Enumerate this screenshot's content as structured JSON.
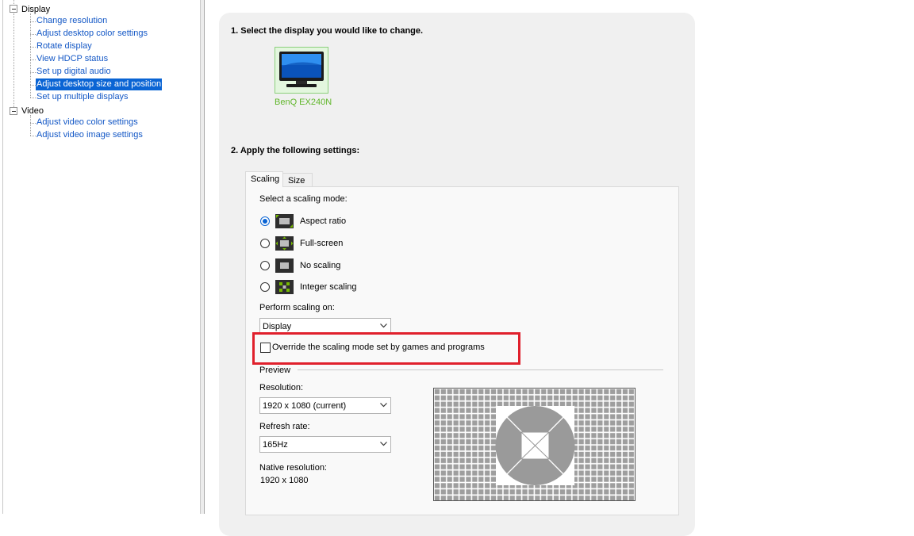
{
  "nav": {
    "categories": [
      {
        "label": "Display",
        "items": [
          {
            "label": "Change resolution"
          },
          {
            "label": "Adjust desktop color settings"
          },
          {
            "label": "Rotate display"
          },
          {
            "label": "View HDCP status"
          },
          {
            "label": "Set up digital audio"
          },
          {
            "label": "Adjust desktop size and position",
            "selected": true
          },
          {
            "label": "Set up multiple displays"
          }
        ]
      },
      {
        "label": "Video",
        "items": [
          {
            "label": "Adjust video color settings"
          },
          {
            "label": "Adjust video image settings"
          }
        ]
      }
    ]
  },
  "step1": {
    "title": "1. Select the display you would like to change.",
    "display_name": "BenQ EX240N"
  },
  "step2": {
    "title": "2. Apply the following settings:",
    "tabs": [
      {
        "label": "Scaling",
        "active": true
      },
      {
        "label": "Size",
        "active": false
      }
    ],
    "scaling_mode_label": "Select a scaling mode:",
    "scaling_modes": [
      {
        "label": "Aspect ratio",
        "checked": true,
        "icon": "aspect-ratio-icon"
      },
      {
        "label": "Full-screen",
        "checked": false,
        "icon": "full-screen-icon"
      },
      {
        "label": "No scaling",
        "checked": false,
        "icon": "no-scaling-icon"
      },
      {
        "label": "Integer scaling",
        "checked": false,
        "icon": "integer-scaling-icon"
      }
    ],
    "perform_on_label": "Perform scaling on:",
    "perform_on_value": "Display",
    "override_label": "Override the scaling mode set by games and programs",
    "override_checked": false,
    "preview": {
      "title": "Preview",
      "resolution_label": "Resolution:",
      "resolution_value": "1920 x 1080 (current)",
      "refresh_label": "Refresh rate:",
      "refresh_value": "165Hz",
      "native_label": "Native resolution:",
      "native_value": "1920 x 1080"
    }
  },
  "colors": {
    "link": "#1458c6",
    "selection": "#0a64d4",
    "display_name": "#5fb62a",
    "highlight": "#e0202c",
    "pane": "#f0f0f0"
  }
}
